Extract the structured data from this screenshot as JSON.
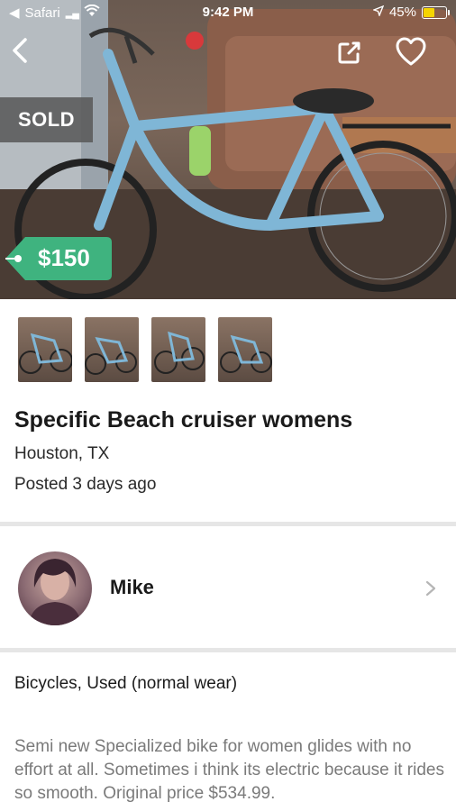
{
  "status_bar": {
    "back_app": "Safari",
    "time": "9:42 PM",
    "battery": "45%",
    "battery_level": 0.45
  },
  "nav": {
    "back_icon": "chevron-left-icon",
    "share_icon": "share-icon",
    "favorite_icon": "heart-icon"
  },
  "listing": {
    "sold_label": "SOLD",
    "price": "$150",
    "photo_count": 4,
    "title": "Specific Beach cruiser womens",
    "location": "Houston, TX",
    "posted": "Posted 3 days ago",
    "category": "Bicycles, Used (normal wear)",
    "description": "Semi new Specialized bike for women glides with no effort at all. Sometimes i think its electric because it rides so smooth. Original price $534.99."
  },
  "seller": {
    "name": "Mike",
    "chevron_icon": "chevron-right-icon"
  },
  "colors": {
    "price_tag": "#3fb37f",
    "sold_badge": "#5a5a5a",
    "divider": "#e6e6e6",
    "bike_frame": "#7fb6d6"
  }
}
